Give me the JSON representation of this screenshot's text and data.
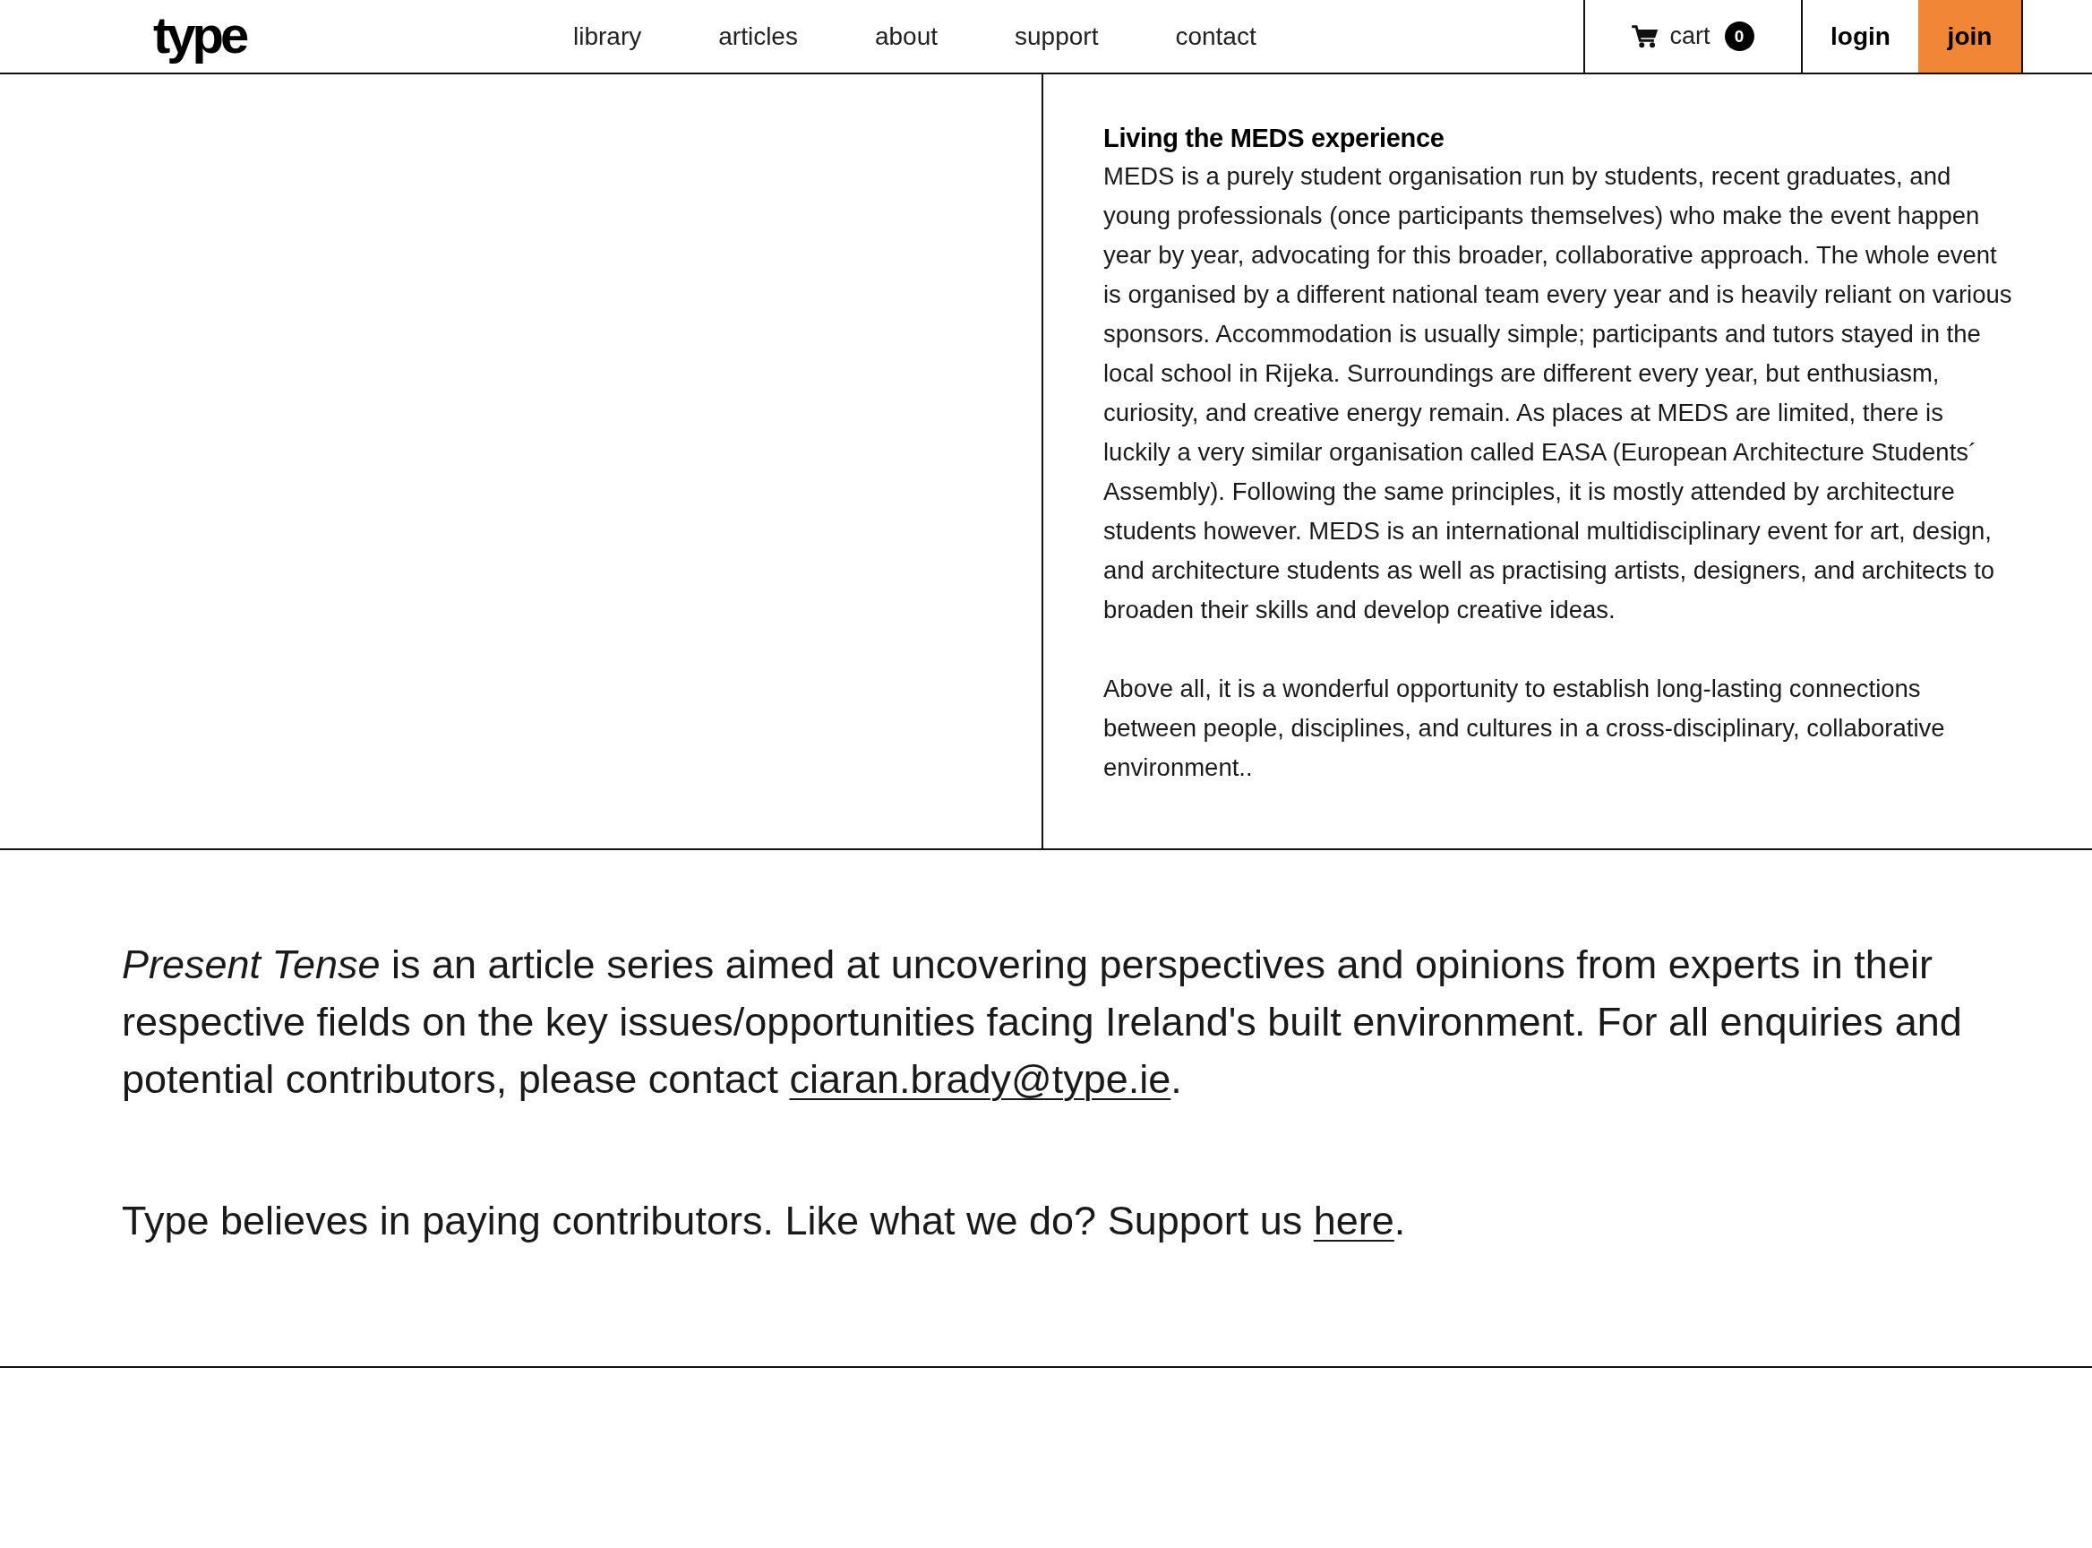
{
  "header": {
    "logo": "type",
    "nav": [
      "library",
      "articles",
      "about",
      "support",
      "contact"
    ],
    "cart": {
      "label": "cart",
      "count": "0"
    },
    "login": "login",
    "join": "join"
  },
  "article_block": {
    "heading": "Living the MEDS experience",
    "paragraphs": [
      "MEDS is a purely student organisation run by students, recent graduates, and young professionals (once participants themselves) who make the event happen year by year, advocating for this broader, collaborative approach. The whole event is organised by a different national team every year and is heavily reliant on various sponsors. Accommodation is usually simple; participants and tutors stayed in the local school in Rijeka. Surroundings are different every year, but enthusiasm, curiosity, and creative energy remain. As places at MEDS are limited, there is luckily a very similar organisation called EASA (European Architecture Students´ Assembly). Following the same principles, it is mostly attended by architecture students however. MEDS is an international multidisciplinary event for art, design, and architecture students as well as practising artists, designers, and architects to broaden their skills and develop creative ideas.",
      "Above all, it is a wonderful opportunity to establish long-lasting connections between people, disciplines, and cultures in a cross-disciplinary, collaborative environment.."
    ]
  },
  "series_note": {
    "intro": {
      "text": "*Present Tense* is an article series aimed at uncovering perspectives and opinions from experts in their respective fields on the key issues/opportunities facing Ireland's built environment. For all enquiries and potential contributors, please contact ",
      "link": "ciaran.brady@type.ie",
      "after": "."
    },
    "support": {
      "text": "Type believes in paying contributors. Like what we do? Support us ",
      "link": "here",
      "after": "."
    }
  }
}
